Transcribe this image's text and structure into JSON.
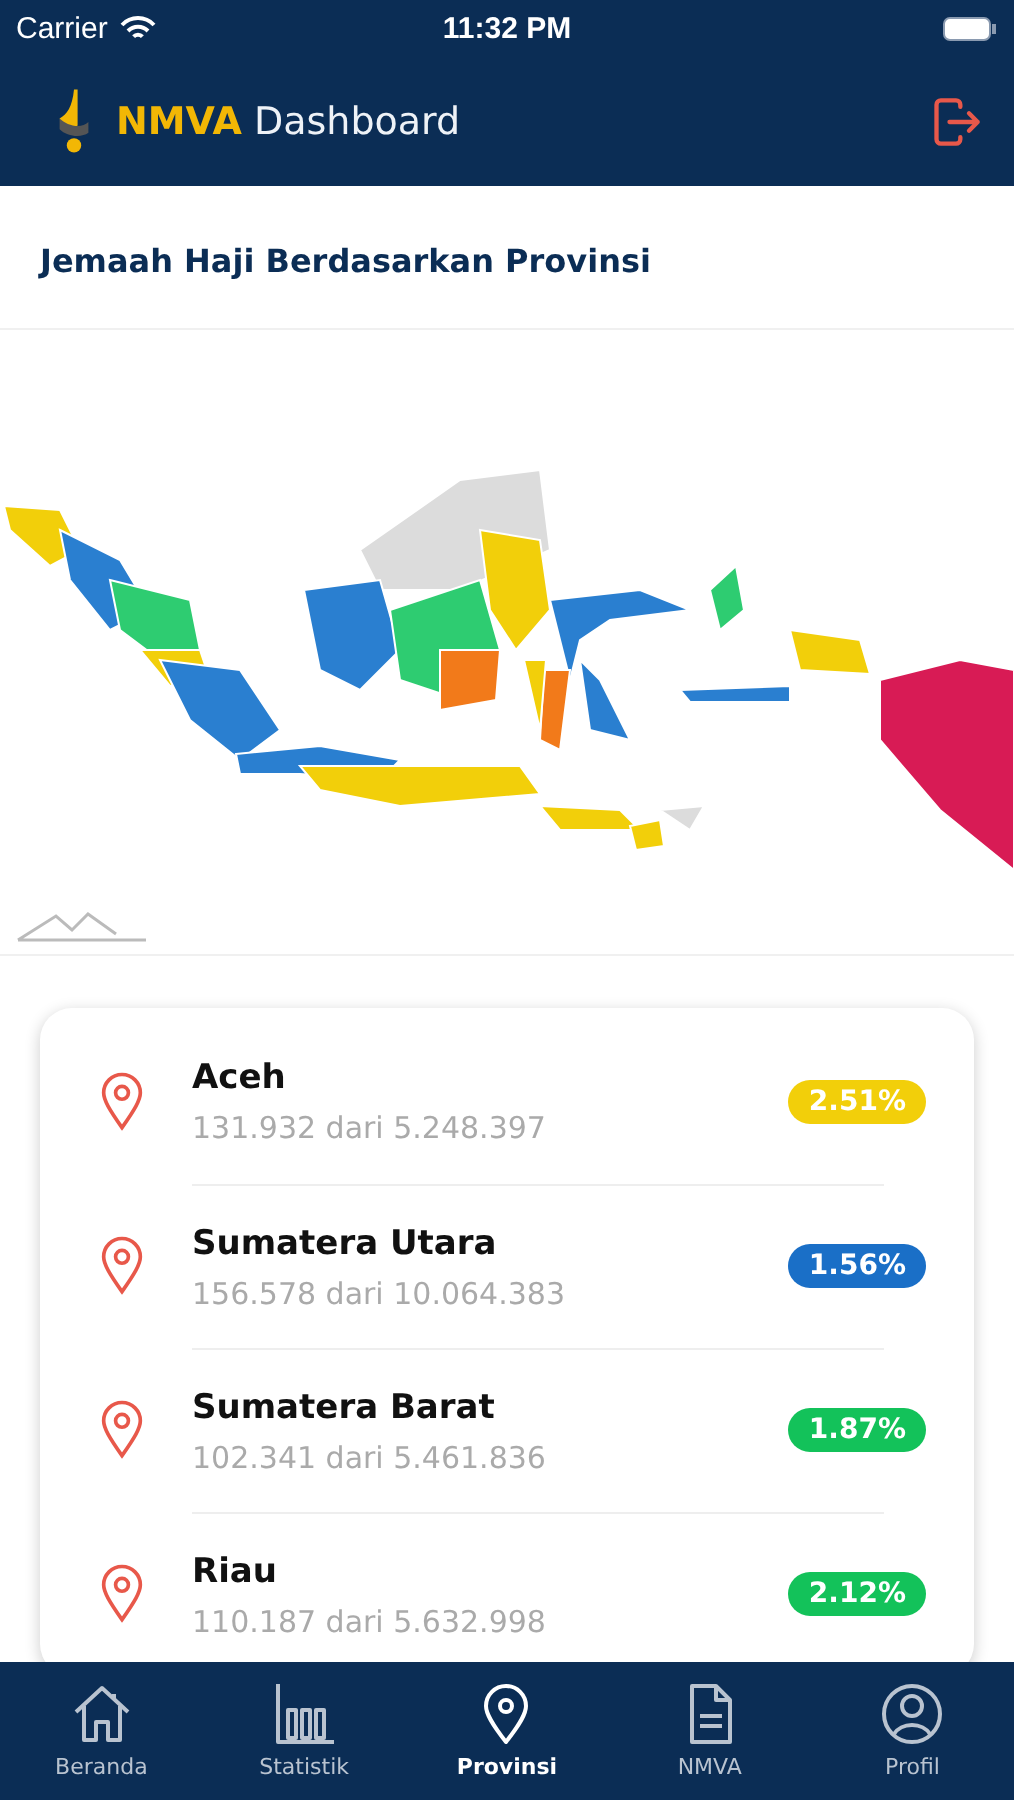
{
  "status_bar": {
    "carrier": "Carrier",
    "time": "11:32 PM"
  },
  "header": {
    "brand": "NMVA",
    "title": "Dashboard"
  },
  "section_title": "Jemaah Haji Berdasarkan Provinsi",
  "provinces": [
    {
      "name": "Aceh",
      "count": "131.932 dari 5.248.397",
      "percent": "2.51%",
      "color": "#f2cf0a"
    },
    {
      "name": "Sumatera Utara",
      "count": "156.578 dari 10.064.383",
      "percent": "1.56%",
      "color": "#1a6fc7"
    },
    {
      "name": "Sumatera Barat",
      "count": "102.341 dari 5.461.836",
      "percent": "1.87%",
      "color": "#13c25a"
    },
    {
      "name": "Riau",
      "count": "110.187 dari 5.632.998",
      "percent": "2.12%",
      "color": "#13c25a"
    }
  ],
  "tabs": [
    {
      "label": "Beranda",
      "kind": "home",
      "selected": false
    },
    {
      "label": "Statistik",
      "kind": "chart",
      "selected": false
    },
    {
      "label": "Provinsi",
      "kind": "pin",
      "selected": true
    },
    {
      "label": "NMVA",
      "kind": "doc",
      "selected": false
    },
    {
      "label": "Profil",
      "kind": "profile",
      "selected": false
    }
  ]
}
